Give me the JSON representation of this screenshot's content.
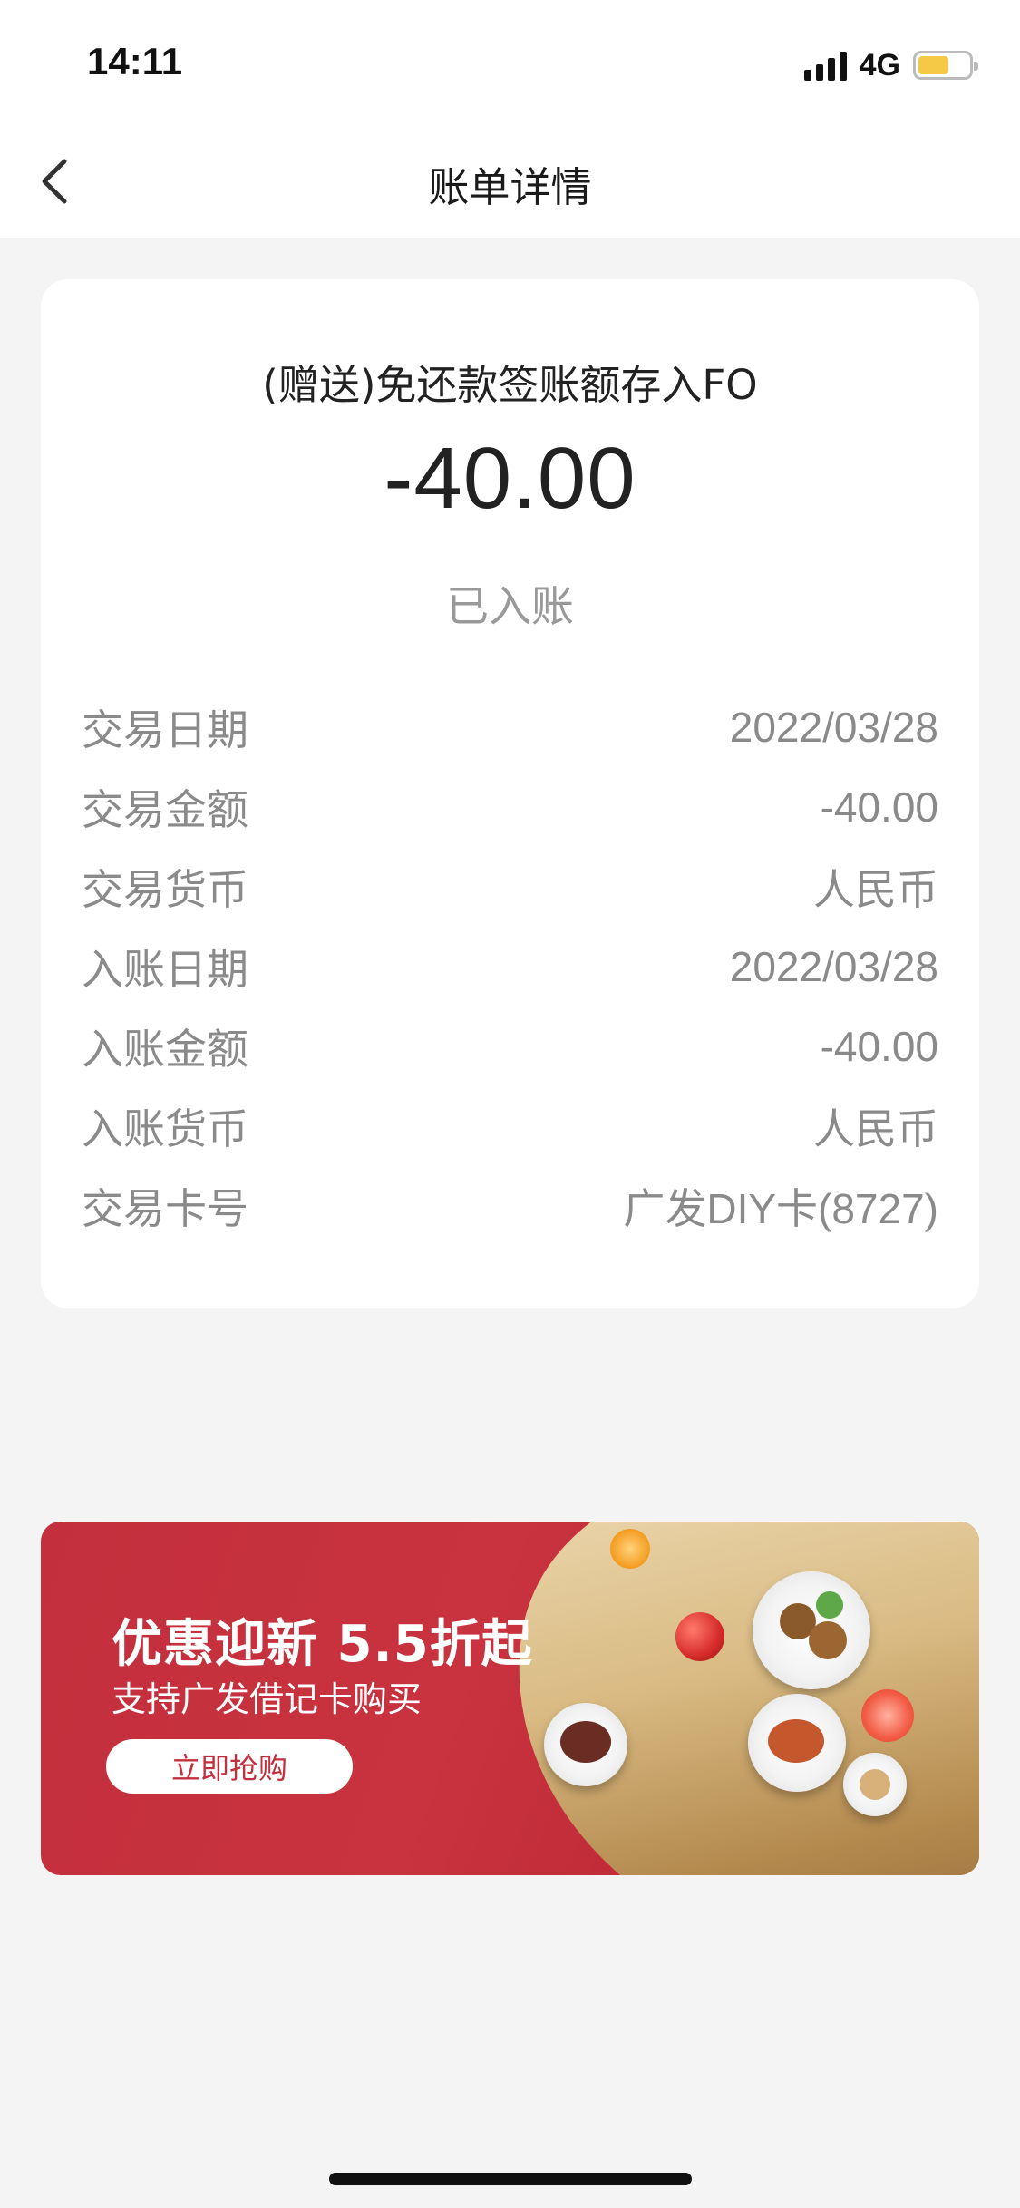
{
  "status_bar": {
    "time": "14:11",
    "network": "4G",
    "icons": [
      "signal-icon",
      "battery-icon"
    ],
    "battery_level": 0.62
  },
  "header": {
    "title": "账单详情",
    "back_icon": "chevron-left-icon"
  },
  "transaction": {
    "description": "(赠送)免还款签账额存入FO",
    "amount": "-40.00",
    "status": "已入账",
    "details": [
      {
        "label": "交易日期",
        "value": "2022/03/28"
      },
      {
        "label": "交易金额",
        "value": "-40.00"
      },
      {
        "label": "交易货币",
        "value": "人民币"
      },
      {
        "label": "入账日期",
        "value": "2022/03/28"
      },
      {
        "label": "入账金额",
        "value": "-40.00"
      },
      {
        "label": "入账货币",
        "value": "人民币"
      },
      {
        "label": "交易卡号",
        "value": "广发DIY卡(8727)"
      }
    ]
  },
  "banner": {
    "headline": "优惠迎新  5.5折起",
    "subtitle": "支持广发借记卡购买",
    "cta_label": "立即抢购",
    "colors": {
      "background": "#c42f3d",
      "cloth": "#d9bb83"
    }
  }
}
